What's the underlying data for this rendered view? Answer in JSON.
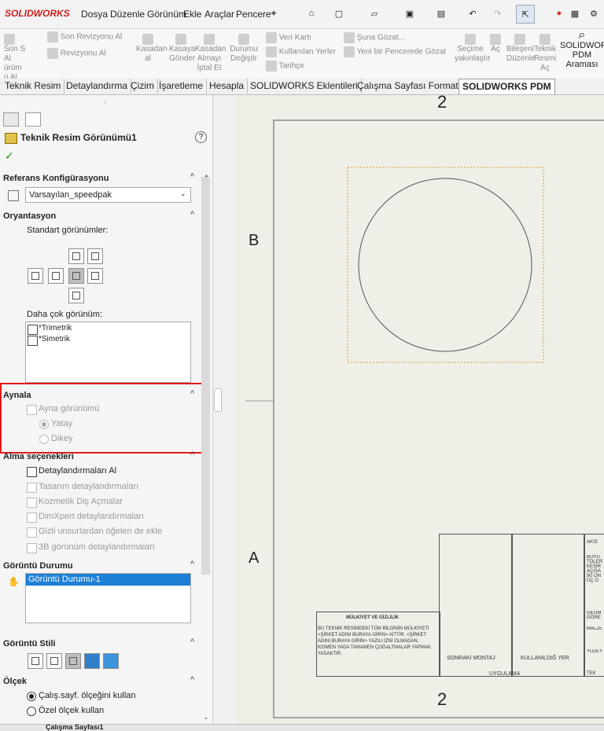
{
  "app": {
    "logo": "SOLIDWORKS"
  },
  "menu": [
    "Dosya",
    "Düzenle",
    "Görünüm",
    "Ekle",
    "Araçlar",
    "Pencere"
  ],
  "cmd": {
    "c1": "Son S Al ürüm ü Al",
    "c2": "Son Revizyonu Al",
    "c3": "Revizyonu Al",
    "c4": "Kasadan al",
    "c5": "Kasaya Gönder",
    "c6": "Kasadan Almayı İptal Et",
    "c7": "Durumu Değiştir",
    "c8": "Veri Kartı",
    "c9": "Kullanılan Yerler",
    "c10": "Tarihçe",
    "c11": "Şuna Gözat...",
    "c12": "Yeni bir Pencerede Gözat",
    "c13": "Seçime yakınlaştır",
    "c14": "Aç",
    "c15": "Bileşeni Düzenle",
    "c16": "Teknik Resmi Aç",
    "c17": "SOLIDWORKS PDM Araması"
  },
  "tabs": [
    "Teknik Resim",
    "Detaylandırma",
    "Çizim",
    "İşaretleme",
    "Hesapla",
    "SOLIDWORKS Eklentileri",
    "Çalışma Sayfası Formatı",
    "SOLIDWORKS PDM"
  ],
  "panel": {
    "title": "Teknik Resim Görünümü1",
    "help": "?",
    "ok": "✓",
    "ref_config": {
      "title": "Referans Konfigürasyonu",
      "value": "Varsayılan_speedpak"
    },
    "orientation": {
      "title": "Oryantasyon",
      "std": "Standart görünümler:",
      "more": "Daha çok görünüm:",
      "items": [
        "*Trimetrik",
        "*Simetrik"
      ]
    },
    "mirror": {
      "title": "Aynala",
      "check": "Ayna görünümü",
      "opt1": "Yatay",
      "opt2": "Dikey"
    },
    "import": {
      "title": "Alma seçenekleri",
      "items": [
        "Detaylandırmaları Al",
        "Tasarım detaylandırmaları",
        "Kozmetik Diş Açmalar",
        "DimXpert detaylandırmaları",
        "Gizli unsurlardan öğeleri de ekle",
        "3B görünüm detaylandırmaları"
      ]
    },
    "display_state": {
      "title": "Görüntü Durumu",
      "item": "Görüntü Durumu-1"
    },
    "display_style": {
      "title": "Görüntü Stili"
    },
    "scale": {
      "title": "Ölçek",
      "opt1": "Çalış.sayf. ölçeğini kullan",
      "opt2": "Özel ölçek kullan"
    }
  },
  "drawing": {
    "zone_top": "2",
    "zone_bottom": "2",
    "zone_b": "B",
    "zone_a": "A",
    "prop_title": "MÜLKİYET VE GİZLİLİK",
    "prop_text": "BU TEKNİK RESİMDEKİ TÜM BİLGİNİN MÜLKİYETİ <ŞİRKET ADINI BURAYA GİRİN> AİTTİR. <ŞİRKET ADINI BURAYA GİRİN> YAZILI İZNİ OLMADAN, KISMEN YADA TAMAMEN ÇOĞALTMALAR YAPMAK YASAKTIR.",
    "next_assy": "SONRAKİ MONTAJ",
    "used_on": "KULLANILDIĞ YER",
    "application": "UYGULAMA",
    "r1": "AKSİ",
    "r2": "BOYU TOLER KESİR AÇISA İKİ ON ÜÇ O",
    "r3": "GEOM GÖRE",
    "r4": "MALZE",
    "r5": "YÜZEY",
    "r6": "TEK"
  },
  "status": {
    "sheet": "Çalışma Sayfası1"
  }
}
